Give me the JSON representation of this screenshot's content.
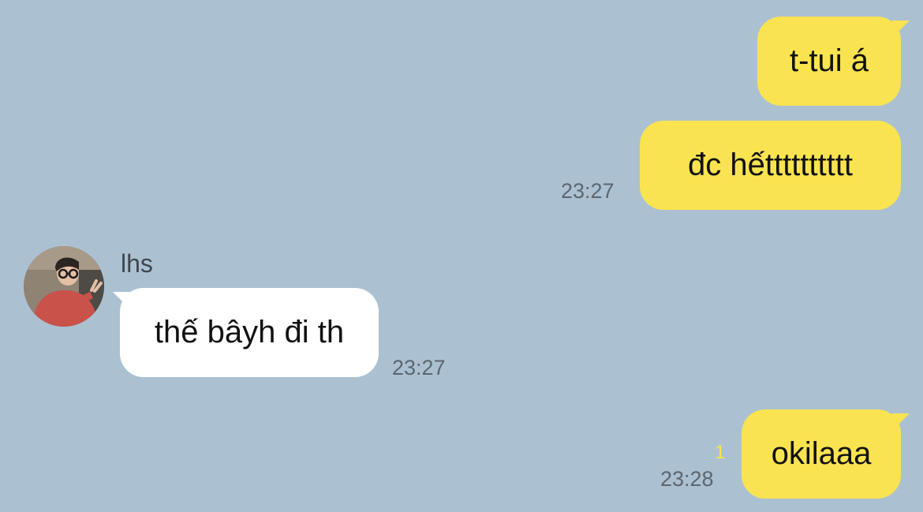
{
  "colors": {
    "background": "#abc1d1",
    "sent_bubble": "#fae350",
    "received_bubble": "#ffffff",
    "time_text": "#5c6670",
    "unread_badge": "#fae350"
  },
  "messages": [
    {
      "direction": "sent",
      "text": "t-tui á"
    },
    {
      "direction": "sent",
      "text": "đc hếtttttttttt",
      "time": "23:27"
    },
    {
      "direction": "received",
      "sender": "lhs",
      "avatar_icon": "user-avatar",
      "text": "thế bâyh đi th",
      "time": "23:27"
    },
    {
      "direction": "sent",
      "text": "okilaaa",
      "time": "23:28",
      "unread_count": "1"
    }
  ]
}
